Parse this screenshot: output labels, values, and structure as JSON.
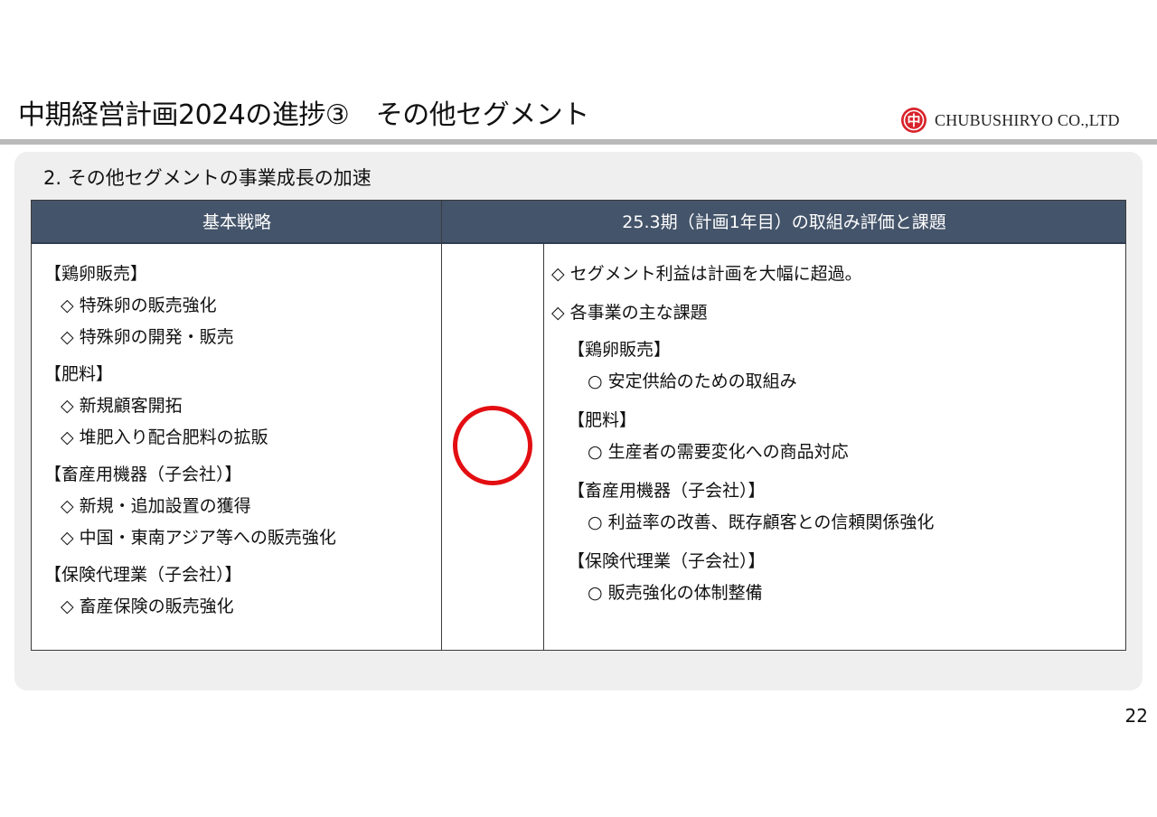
{
  "header": {
    "title": "中期経営計画2024の進捗③　その他セグメント",
    "logo_text": "CHUBUSHIRYO CO.,LTD",
    "logo_mark_glyph": "中",
    "logo_color": "#d8232a"
  },
  "section": {
    "subtitle": "2. その他セグメントの事業成長の加速"
  },
  "table": {
    "header_left": "基本戦略",
    "header_right": "25.3期（計画1年目）の取組み評価と課題",
    "header_bg": "#44546a",
    "left_lines": [
      "【鶏卵販売】",
      "◇ 特殊卵の販売強化",
      "◇ 特殊卵の開発・販売",
      "【肥料】",
      "◇ 新規顧客開拓",
      "◇ 堆肥入り配合肥料の拡販",
      "【畜産用機器（子会社）】",
      "◇ 新規・追加設置の獲得",
      "◇ 中国・東南アジア等への販売強化",
      "【保険代理業（子会社）】",
      "◇ 畜産保険の販売強化"
    ],
    "evaluation_mark": "○",
    "evaluation_color": "#e30e12",
    "right_lines": [
      "◇ セグメント利益は計画を大幅に超過。",
      "◇ 各事業の主な課題",
      "【鶏卵販売】",
      "○ 安定供給のための取組み",
      "【肥料】",
      "○ 生産者の需要変化への商品対応",
      "【畜産用機器（子会社）】",
      "○ 利益率の改善、既存顧客との信頼関係強化",
      "【保険代理業（子会社）】",
      "○ 販売強化の体制整備"
    ]
  },
  "footer": {
    "page_number": "22"
  }
}
